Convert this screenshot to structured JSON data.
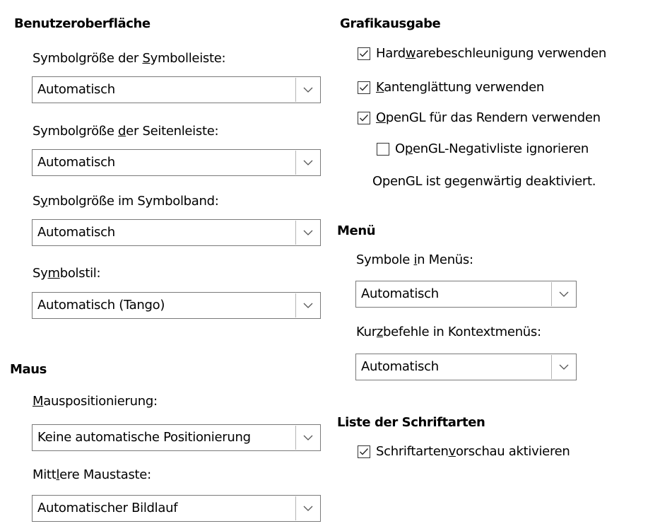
{
  "ui": {
    "title": "Benutzeroberfläche",
    "toolbar_label": [
      "Symbolgröße der ",
      "S",
      "ymbolleiste:"
    ],
    "toolbar_value": "Automatisch",
    "sidebar_label": [
      "Symbolgröße ",
      "d",
      "er Seitenleiste:"
    ],
    "sidebar_value": "Automatisch",
    "notebookbar_label": [
      "S",
      "y",
      "mbolgröße im Symbolband:"
    ],
    "notebookbar_value": "Automatisch",
    "style_label": [
      "Sy",
      "m",
      "bolstil:"
    ],
    "style_value": "Automatisch (Tango)"
  },
  "mouse": {
    "title": "Maus",
    "positioning_label": [
      "",
      "M",
      "auspositionierung:"
    ],
    "positioning_value": "Keine automatische Positionierung",
    "middle_label": [
      "Mitt",
      "l",
      "ere Maustaste:"
    ],
    "middle_value": "Automatischer Bildlauf"
  },
  "graphics": {
    "title": "Grafikausgabe",
    "hw_accel": {
      "parts": [
        "Hard",
        "w",
        "arebeschleunigung verwenden"
      ],
      "checked": true
    },
    "antialias": {
      "parts": [
        "",
        "K",
        "antenglättung verwenden"
      ],
      "checked": true
    },
    "opengl": {
      "parts": [
        "",
        "O",
        "penGL für das Rendern verwenden"
      ],
      "checked": true
    },
    "opengl_blacklist": {
      "parts": [
        "O",
        "p",
        "enGL-Negativliste ignorieren"
      ],
      "checked": false
    },
    "status": "OpenGL ist gegenwärtig deaktiviert."
  },
  "menu": {
    "title": "Menü",
    "icons_label": [
      "Symbole ",
      "i",
      "n Menüs:"
    ],
    "icons_value": "Automatisch",
    "shortcuts_label": [
      "Kur",
      "z",
      "befehle in Kontextmenüs:"
    ],
    "shortcuts_value": "Automatisch"
  },
  "fonts": {
    "title": "Liste der Schriftarten",
    "preview": {
      "parts": [
        "Schriftarten",
        "v",
        "orschau aktivieren"
      ],
      "checked": true
    }
  }
}
